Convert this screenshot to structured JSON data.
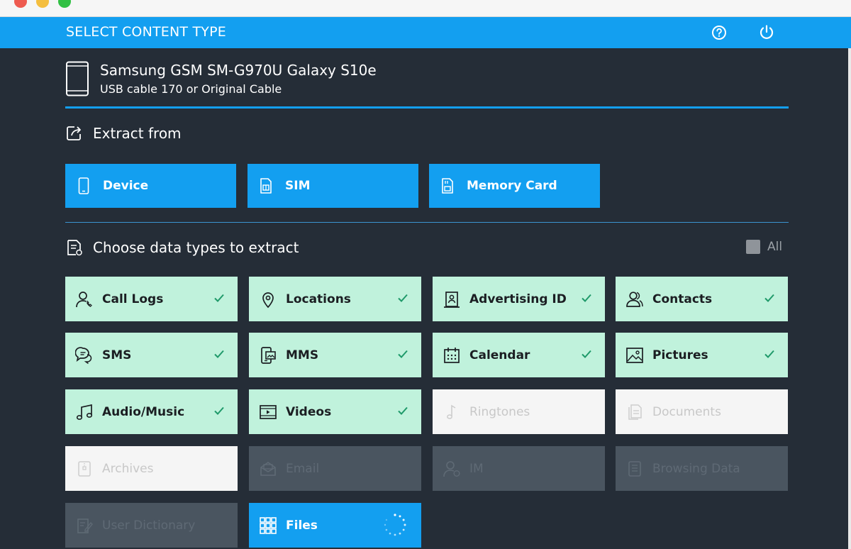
{
  "header": {
    "title": "SELECT CONTENT TYPE",
    "help_icon": "help-circle-icon",
    "power_icon": "power-icon"
  },
  "device": {
    "name": "Samsung GSM SM-G970U Galaxy S10e",
    "connection": "USB cable 170 or Original Cable",
    "icon": "phone-icon"
  },
  "extract_from": {
    "title": "Extract from",
    "options": [
      {
        "label": "Device",
        "icon": "phone-small-icon"
      },
      {
        "label": "SIM",
        "icon": "sim-card-icon"
      },
      {
        "label": "Memory Card",
        "icon": "memory-card-icon"
      }
    ]
  },
  "data_types": {
    "title": "Choose data types to extract",
    "all_label": "All",
    "items": [
      {
        "label": "Call Logs",
        "state": "selected",
        "icon": "call-log-icon"
      },
      {
        "label": "Locations",
        "state": "selected",
        "icon": "location-pin-icon"
      },
      {
        "label": "Advertising ID",
        "state": "selected",
        "icon": "id-badge-icon"
      },
      {
        "label": "Contacts",
        "state": "selected",
        "icon": "contacts-icon"
      },
      {
        "label": "SMS",
        "state": "selected",
        "icon": "sms-icon"
      },
      {
        "label": "MMS",
        "state": "selected",
        "icon": "mms-icon"
      },
      {
        "label": "Calendar",
        "state": "selected",
        "icon": "calendar-icon"
      },
      {
        "label": "Pictures",
        "state": "selected",
        "icon": "picture-icon"
      },
      {
        "label": "Audio/Music",
        "state": "selected",
        "icon": "music-note-icon"
      },
      {
        "label": "Videos",
        "state": "selected",
        "icon": "video-icon"
      },
      {
        "label": "Ringtones",
        "state": "unselected",
        "icon": "ringtone-icon"
      },
      {
        "label": "Documents",
        "state": "unselected",
        "icon": "documents-icon"
      },
      {
        "label": "Archives",
        "state": "unselected",
        "icon": "archive-icon"
      },
      {
        "label": "Email",
        "state": "disabled",
        "icon": "email-icon"
      },
      {
        "label": "IM",
        "state": "disabled",
        "icon": "im-user-icon"
      },
      {
        "label": "Browsing Data",
        "state": "disabled",
        "icon": "browsing-data-icon"
      },
      {
        "label": "User Dictionary",
        "state": "disabled",
        "icon": "dictionary-icon"
      },
      {
        "label": "Files",
        "state": "loading",
        "icon": "grid-files-icon"
      }
    ]
  },
  "colors": {
    "accent": "#139ff0",
    "selected_tile": "#c0f2dc",
    "check": "#1f9a6a",
    "background": "#252d37"
  }
}
